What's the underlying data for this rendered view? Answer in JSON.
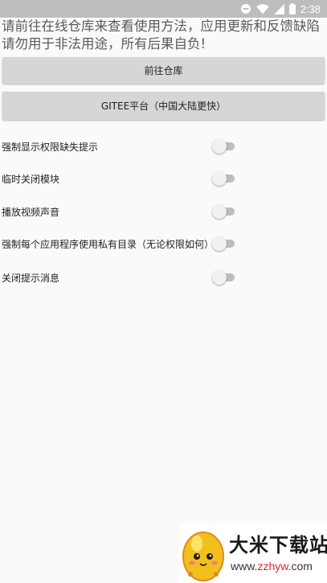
{
  "status_bar": {
    "time": "2:38",
    "icons": [
      "do-not-disturb-icon",
      "wifi-icon",
      "signal-icon",
      "battery-icon"
    ]
  },
  "notice": {
    "line1": "请前往在线仓库来查看使用方法，应用更新和反馈缺陷",
    "line2": "请勿用于非法用途，所有后果自负!"
  },
  "buttons": {
    "repo": "前往仓库",
    "gitee": "GITEE平台（中国大陆更快）"
  },
  "settings": [
    {
      "label": "强制显示权限缺失提示",
      "enabled": false
    },
    {
      "label": "临时关闭模块",
      "enabled": false
    },
    {
      "label": "播放视频声音",
      "enabled": false
    },
    {
      "label": "强制每个应用程序使用私有目录（无论权限如何）",
      "enabled": false
    },
    {
      "label": "关闭提示消息",
      "enabled": false
    }
  ],
  "watermark": {
    "title": "大米下载站",
    "url_prefix": "www.",
    "url_accent": "zzhyw",
    "url_suffix": ".com",
    "accent_color": "#d9252b",
    "logo": "rice-mascot-logo"
  }
}
